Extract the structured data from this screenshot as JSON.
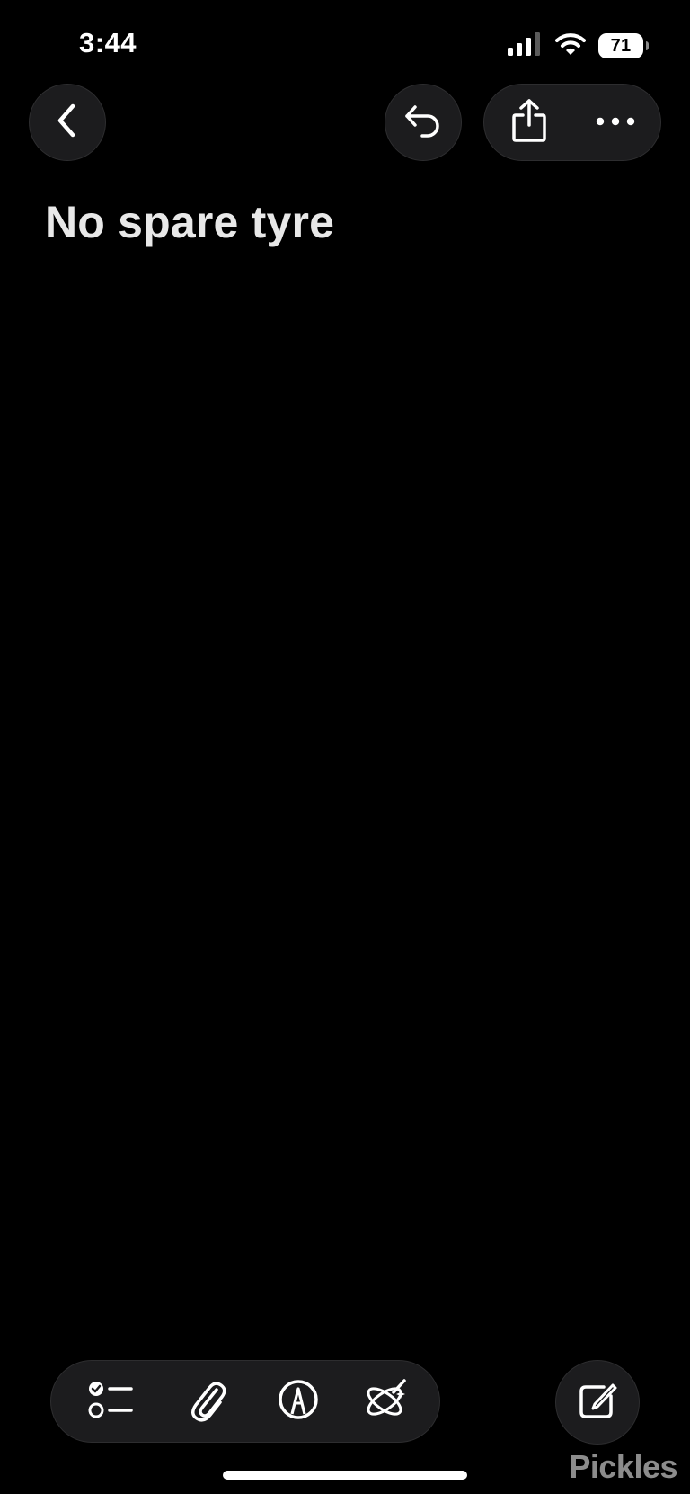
{
  "status_bar": {
    "time": "3:44",
    "battery_level": "71",
    "icons": [
      "cellular-signal-icon",
      "wifi-icon",
      "battery-icon"
    ]
  },
  "nav": {
    "left": [
      "back-chevron-icon"
    ],
    "right": [
      "undo-icon",
      "share-icon",
      "more-ellipsis-icon"
    ]
  },
  "note": {
    "title": "No spare tyre"
  },
  "toolbar": {
    "tools": [
      "checklist-icon",
      "paperclip-icon",
      "markup-pen-icon",
      "writing-tools-icon"
    ],
    "compose": "compose-note-icon"
  },
  "watermark": "Pickles",
  "colors": {
    "background": "#000000",
    "button_fill": "#1c1c1e",
    "title_text": "#e8e8e8",
    "icon": "#ffffff"
  }
}
